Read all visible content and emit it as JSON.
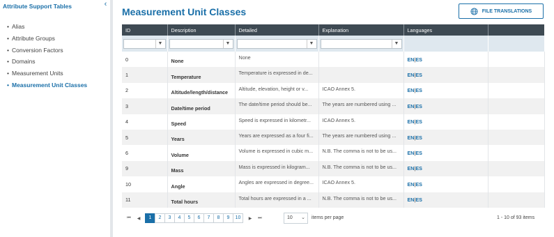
{
  "sidebar": {
    "title": "Attribute Support Tables",
    "items": [
      {
        "label": "Alias"
      },
      {
        "label": "Attribute Groups"
      },
      {
        "label": "Conversion Factors"
      },
      {
        "label": "Domains"
      },
      {
        "label": "Measurement Units"
      },
      {
        "label": "Measurement Unit Classes",
        "active": true
      }
    ],
    "collapse_icon": "chevron-left-icon"
  },
  "header": {
    "title": "Measurement Unit Classes",
    "file_button_label": "FILE TRANSLATIONS",
    "file_button_icon": "translate-icon"
  },
  "table": {
    "columns": [
      "ID",
      "Description",
      "Detailed",
      "Explanation",
      "Languages"
    ],
    "filter_icon": "funnel-icon",
    "rows": [
      {
        "id": "0",
        "description": "None",
        "detailed": "None",
        "explanation": "",
        "lang1": "EN",
        "lang2": "ES"
      },
      {
        "id": "1",
        "description": "Temperature",
        "detailed": "Temperature is expressed in de...",
        "explanation": "",
        "lang1": "EN",
        "lang2": "ES"
      },
      {
        "id": "2",
        "description": "Altitude/length/distance",
        "detailed": "Altitude, elevation, height or v...",
        "explanation": "ICAO Annex 5.",
        "lang1": "EN",
        "lang2": "ES"
      },
      {
        "id": "3",
        "description": "Date/time period",
        "detailed": "The date/time period should be...",
        "explanation": "The years are numbered using ...",
        "lang1": "EN",
        "lang2": "ES"
      },
      {
        "id": "4",
        "description": "Speed",
        "detailed": "Speed is expressed in kilometr...",
        "explanation": "ICAO Annex 5.",
        "lang1": "EN",
        "lang2": "ES"
      },
      {
        "id": "5",
        "description": "Years",
        "detailed": "Years are expressed as a four fi...",
        "explanation": "The years are numbered using ...",
        "lang1": "EN",
        "lang2": "ES"
      },
      {
        "id": "6",
        "description": "Volume",
        "detailed": "Volume is expressed in cubic m...",
        "explanation": "N.B. The comma is not to be us...",
        "lang1": "EN",
        "lang2": "ES"
      },
      {
        "id": "9",
        "description": "Mass",
        "detailed": "Mass is expressed in kilogram...",
        "explanation": "N.B. The comma is not to be us...",
        "lang1": "EN",
        "lang2": "ES"
      },
      {
        "id": "10",
        "description": "Angle",
        "detailed": "Angles are expressed in degree...",
        "explanation": "ICAO Annex 5.",
        "lang1": "EN",
        "lang2": "ES"
      },
      {
        "id": "11",
        "description": "Total hours",
        "detailed": "Total hours are expressed in a ...",
        "explanation": "N.B. The comma is not to be us...",
        "lang1": "EN",
        "lang2": "ES"
      }
    ]
  },
  "pagination": {
    "first_icon": "first-page-icon",
    "prev_icon": "prev-page-icon",
    "next_icon": "next-page-icon",
    "last_icon": "last-page-icon",
    "pages": [
      "1",
      "2",
      "3",
      "4",
      "5",
      "6",
      "7",
      "8",
      "9",
      "10"
    ],
    "current_page": "1",
    "per_page_value": "10",
    "per_page_label": "items per page",
    "items_count": "1 - 10 of 93 items"
  },
  "colors": {
    "accent": "#1a6fa8",
    "header_bg": "#3e4a53",
    "filter_bg": "#dfe8ef"
  }
}
